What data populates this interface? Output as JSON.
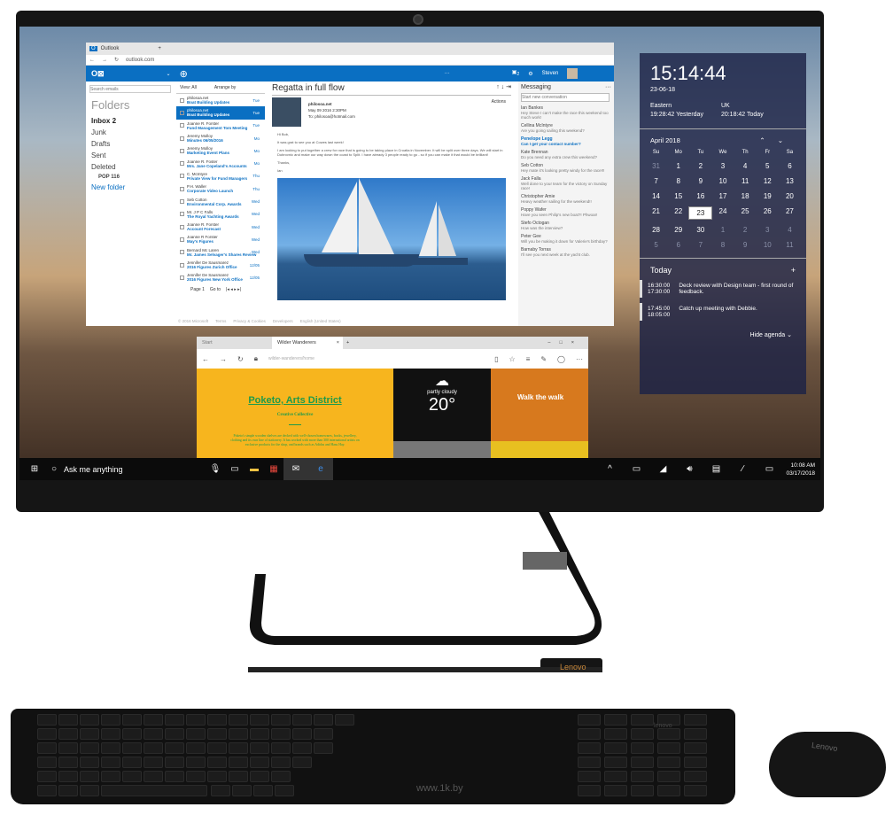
{
  "outlook": {
    "tab_title": "Outlook",
    "url": "outlook.com",
    "user": "Steven",
    "chat_count": "2",
    "more": "···",
    "search_placeholder": "Search emails",
    "folders_title": "Folders",
    "folders": [
      {
        "label": "Inbox",
        "count": "2"
      },
      {
        "label": "Junk"
      },
      {
        "label": "Drafts"
      },
      {
        "label": "Sent"
      },
      {
        "label": "Deleted"
      },
      {
        "label": "POP",
        "count": "116"
      },
      {
        "label": "New folder"
      }
    ],
    "list_header": {
      "view": "View: All",
      "arrange": "Arrange by"
    },
    "emails": [
      {
        "from": "philosoa.net",
        "subject": "Boat Building Updates",
        "day": "Tue"
      },
      {
        "from": "philosoa.net",
        "subject": "Boat Building Updates",
        "day": "Tue",
        "selected": true
      },
      {
        "from": "Joanne R. Forster",
        "subject": "Fund Management Tom Meeting",
        "day": "Tue"
      },
      {
        "from": "Jeremy Molloy",
        "subject": "Minutes 06/05/2016",
        "day": "Mo"
      },
      {
        "from": "Jeremy Molloy",
        "subject": "Marketing Event Plans",
        "day": "Mo"
      },
      {
        "from": "Joanne R. Foster",
        "subject": "Mrs. Jane Copeland's Accounts",
        "day": "Mo"
      },
      {
        "from": "C. McIntyre",
        "subject": "Private View for Fund Managers",
        "day": "Thu"
      },
      {
        "from": "P.H. Waller",
        "subject": "Corporate Video Launch",
        "day": "Thu"
      },
      {
        "from": "Seb Cotton",
        "subject": "Environmental Corp. Awards",
        "day": "Wed"
      },
      {
        "from": "Mr. J P C Falls",
        "subject": "The Royal Yachting Awards",
        "day": "Wed"
      },
      {
        "from": "Joanne R. Forster",
        "subject": "Account Forecast",
        "day": "Wed"
      },
      {
        "from": "Joanne R Forster",
        "subject": "May's Figures",
        "day": "Wed"
      },
      {
        "from": "Bernard Mc Laren",
        "subject": "Mr. James Selvager's Shares Review",
        "day": "Wed"
      },
      {
        "from": "Jennifer De Sausmarez",
        "subject": "2016 Figures Zurich Office",
        "day": "12/05"
      },
      {
        "from": "Jennifer De Sausmarez",
        "subject": "2016 Figures New York Office",
        "day": "12/05"
      }
    ],
    "pager": {
      "page": "Page 1",
      "goto": "Go to"
    },
    "footer": [
      "© 2016 Microsoft",
      "Terms",
      "Privacy & Cookies",
      "Developers",
      "English (United States)"
    ],
    "reading": {
      "subject": "Regatta in full flow",
      "actions": "Actions",
      "sender": "philosoa.net",
      "date": "May 09 2016 2:30PM",
      "to": "To: philosoa@hotmail.com",
      "body": [
        "Hi Bob,",
        "It was grat to see you at Cowes last week!",
        "I am looking to put together a crew for race that is going to be taking place in Croatia in November. It will be split over three days. We will start in Dubrovnic and make our way down the coast to Split. I have already 3 people ready to go - so if you can make it that would be brilliant!",
        "Thanks,",
        "Ian"
      ]
    },
    "messaging": {
      "title": "Messaging",
      "more": "···",
      "placeholder": "Start new conversation",
      "items": [
        {
          "name": "Ian Bankes",
          "preview": "Hey Steve I can't make the race this weekend too much work!"
        },
        {
          "name": "Cellina McIntyre",
          "preview": "Are you going sailing this weekend?"
        },
        {
          "name": "Penelope Legg",
          "preview": "Can I get your contact number?",
          "highlight": true
        },
        {
          "name": "Kate Brennan",
          "preview": "Do you need any extra crew this weekend?"
        },
        {
          "name": "Seb Cotton",
          "preview": "Hey mate it's looking pretty windy for the race!!!"
        },
        {
          "name": "Jack Falla",
          "preview": "Well done to your team for the victory on Sunday race!"
        },
        {
          "name": "Christopher Amie",
          "preview": "Heavy weather sailing for the weekend!!"
        },
        {
          "name": "Poppy Wafer",
          "preview": "Have you seen Philip's new boat?! Phwoar!"
        },
        {
          "name": "Stefo Octogan",
          "preview": "How was the interview?"
        },
        {
          "name": "Peter Gee",
          "preview": "Will you be making it down for Valerie's birthday?"
        },
        {
          "name": "Barnaby Torras",
          "preview": "I'll see you next week at the yacht club."
        }
      ]
    }
  },
  "edge": {
    "tab_start": "Start",
    "tab_active": "Wilder Wanderers",
    "url": "wilder-wanderers/home",
    "hero_title": "Poketo, Arts District",
    "hero_sub": "Creative Collective",
    "hero_text": "Poketo's simple wooden shelves are decked with well-chosen homewares, books, jewellery, clothing and its own line of stationery. It has worked with more than 300 international artists on exclusive products for the shop, and brands such as Adidas and Hasu Hay.",
    "weather": "partly cloudy",
    "temp": "20°",
    "walk": "Walk the walk"
  },
  "clock": {
    "time": "15:14:44",
    "date": "23-06-18",
    "zones": [
      {
        "name": "Eastern",
        "time": "19:28:42 Yesterday"
      },
      {
        "name": "UK",
        "time": "20:18:42 Today"
      }
    ],
    "month": "April 2018",
    "weekdays": [
      "Su",
      "Mo",
      "Tu",
      "We",
      "Th",
      "Fr",
      "Sa"
    ],
    "days": [
      "31",
      "1",
      "2",
      "3",
      "4",
      "5",
      "6",
      "7",
      "8",
      "9",
      "10",
      "11",
      "12",
      "13",
      "14",
      "15",
      "16",
      "17",
      "18",
      "19",
      "20",
      "21",
      "22",
      "23",
      "24",
      "25",
      "26",
      "27",
      "28",
      "29",
      "30",
      "1",
      "2",
      "3",
      "4",
      "5",
      "6",
      "7",
      "8",
      "9",
      "10",
      "11"
    ],
    "today": "23",
    "agenda_title": "Today",
    "agenda": [
      {
        "start": "16:30:00",
        "end": "17:30:00",
        "text": "Deck review with Design team - first round of feedback."
      },
      {
        "start": "17:45:00",
        "end": "18:05:00",
        "text": "Catch up meeting with Debbie."
      }
    ],
    "hide": "Hide agenda"
  },
  "taskbar": {
    "search": "Ask me anything",
    "time": "10:08 AM",
    "date": "03/17/2018"
  },
  "brand": "Lenovo",
  "watermark": "www.1k.by",
  "colors": {
    "outlook_blue": "#0a6fc2",
    "edge_yellow": "#f7b51e",
    "calendar_panel": "#1c2246"
  }
}
